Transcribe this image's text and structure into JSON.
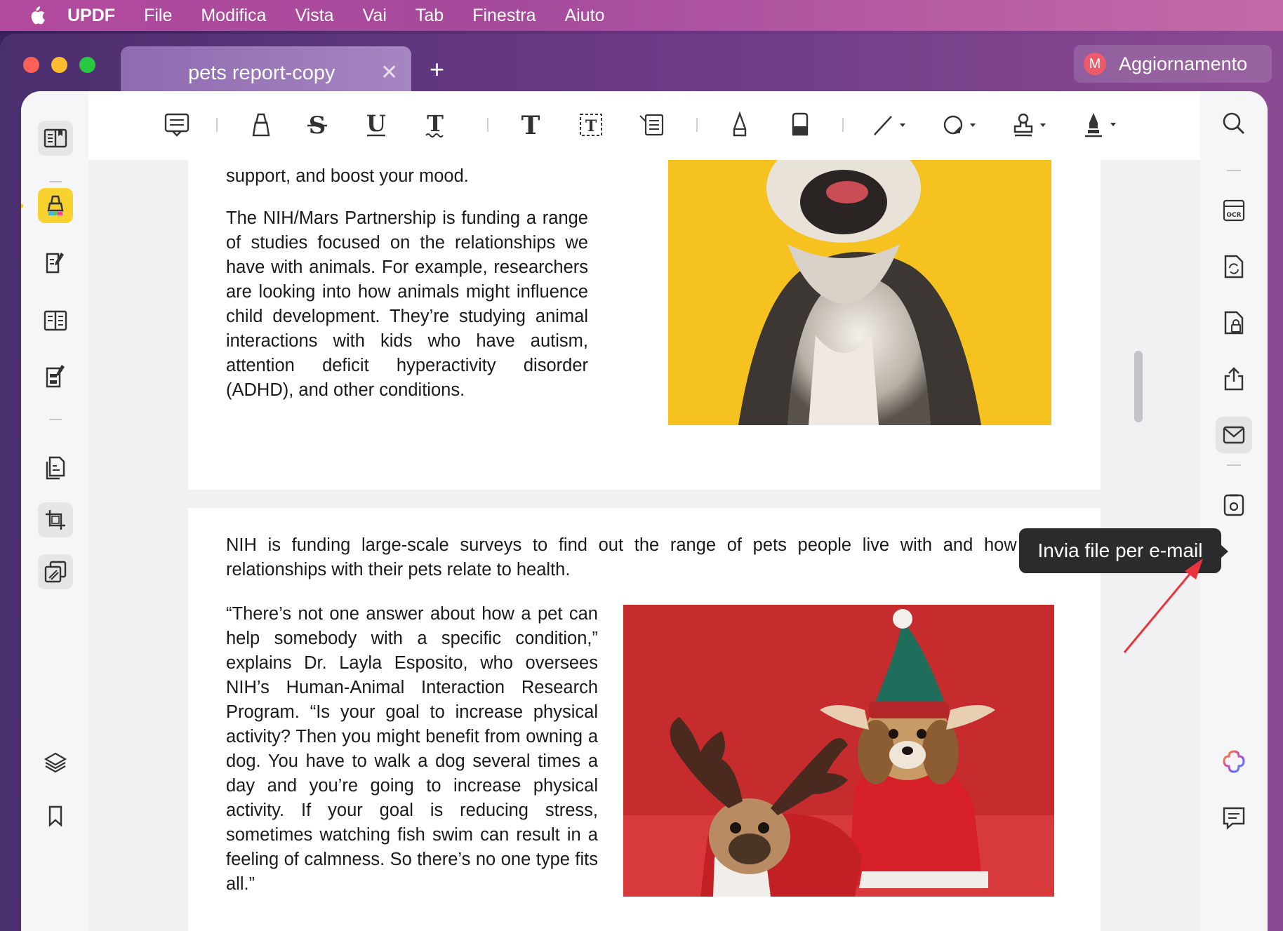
{
  "menubar": {
    "app_name": "UPDF",
    "items": [
      "File",
      "Modifica",
      "Vista",
      "Vai",
      "Tab",
      "Finestra",
      "Aiuto"
    ]
  },
  "tab": {
    "title": "pets report-copy",
    "close": "✕",
    "new": "+"
  },
  "update": {
    "avatar_letter": "M",
    "label": "Aggiornamento"
  },
  "tooltip": {
    "text": "Invia file per e-mail"
  },
  "document": {
    "p1_top": "support, and boost your mood.",
    "p2": "The NIH/Mars Partnership is funding a range of studies focused on the relationships we have with animals. For example, researchers are looking into how animals might influence child development. They’re studying animal interactions with kids who have autism, attention deficit hyperactivity disorder (ADHD), and other conditions.",
    "p3": "NIH is funding large-scale surveys to find out the range of pets people live with and how their relationships with their pets relate to health.",
    "p4": "“There’s not one answer about how a pet can help somebody with a specific condition,” explains Dr. Layla Esposito, who oversees NIH’s Human-Animal Interaction Research Program. “Is your goal to increase physical activity? Then you might benefit from owning a dog. You have to walk a dog several times a day and you’re going to increase physical activity. If your goal is reducing stress, sometimes watching fish swim can result in a feeling of calmness. So there’s no one type fits all.”"
  },
  "colors": {
    "accent_yellow": "#f8d22e",
    "photo1_bg": "#f6c21f",
    "photo2_bg": "#c8282c",
    "arrow": "#e8343a"
  }
}
